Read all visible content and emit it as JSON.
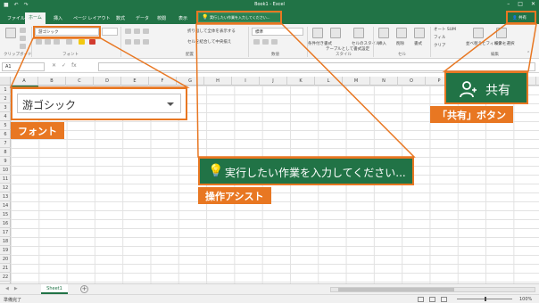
{
  "app": {
    "window_title": "Book1 - Excel",
    "signin_label": "サインイン",
    "share_label": "共有",
    "qat_icons": [
      "save-icon",
      "undo-icon",
      "redo-icon"
    ],
    "window_controls": [
      "minimize-icon",
      "maximize-icon",
      "close-icon"
    ]
  },
  "tabs": [
    {
      "label": "ファイル",
      "active": false
    },
    {
      "label": "ホーム",
      "active": true
    },
    {
      "label": "挿入",
      "active": false
    },
    {
      "label": "ページ レイアウト",
      "active": false
    },
    {
      "label": "数式",
      "active": false
    },
    {
      "label": "データ",
      "active": false
    },
    {
      "label": "校閲",
      "active": false
    },
    {
      "label": "表示",
      "active": false
    }
  ],
  "tell_me": {
    "placeholder": "実行したい作業を入力してください..."
  },
  "ribbon": {
    "font_name": "游ゴシック",
    "number_format": "標準",
    "wrap_text_label": "折り返して全体を表示する",
    "merge_label": "セルを結合して中央揃え",
    "groups": [
      "クリップボード",
      "フォント",
      "配置",
      "数値",
      "スタイル",
      "セル",
      "編集"
    ],
    "style_buttons": [
      "条件付き書式",
      "テーブルとして書式設定",
      "セルのスタイル"
    ],
    "cell_buttons": [
      "挿入",
      "削除",
      "書式"
    ],
    "edit_buttons": [
      "オート SUM",
      "フィル",
      "クリア",
      "並べ替えとフィルター",
      "検索と選択"
    ]
  },
  "formula_bar": {
    "name_box": "A1",
    "formula": ""
  },
  "grid": {
    "columns": [
      "A",
      "B",
      "C",
      "D",
      "E",
      "F",
      "G",
      "H",
      "I",
      "J",
      "K",
      "L",
      "M",
      "N",
      "O",
      "P",
      "Q",
      "R",
      "S"
    ],
    "rows": [
      "1",
      "2",
      "3",
      "4",
      "5",
      "6",
      "7",
      "8",
      "9",
      "10",
      "11",
      "12",
      "13",
      "14",
      "15",
      "16",
      "17",
      "18",
      "19",
      "20",
      "21",
      "22"
    ]
  },
  "sheets": {
    "tabs": [
      "Sheet1"
    ],
    "active": "Sheet1"
  },
  "status": {
    "text": "準備完了",
    "zoom": "100%"
  },
  "callouts": {
    "font": {
      "label": "フォント",
      "sample": "游ゴシック"
    },
    "tell_me": {
      "label": "操作アシスト",
      "text": "実行したい作業を入力してください..."
    },
    "share": {
      "label": "「共有」ボタン",
      "button_text": "共有"
    }
  },
  "colors": {
    "excel_green": "#217346",
    "annotation_orange": "#e87722"
  }
}
